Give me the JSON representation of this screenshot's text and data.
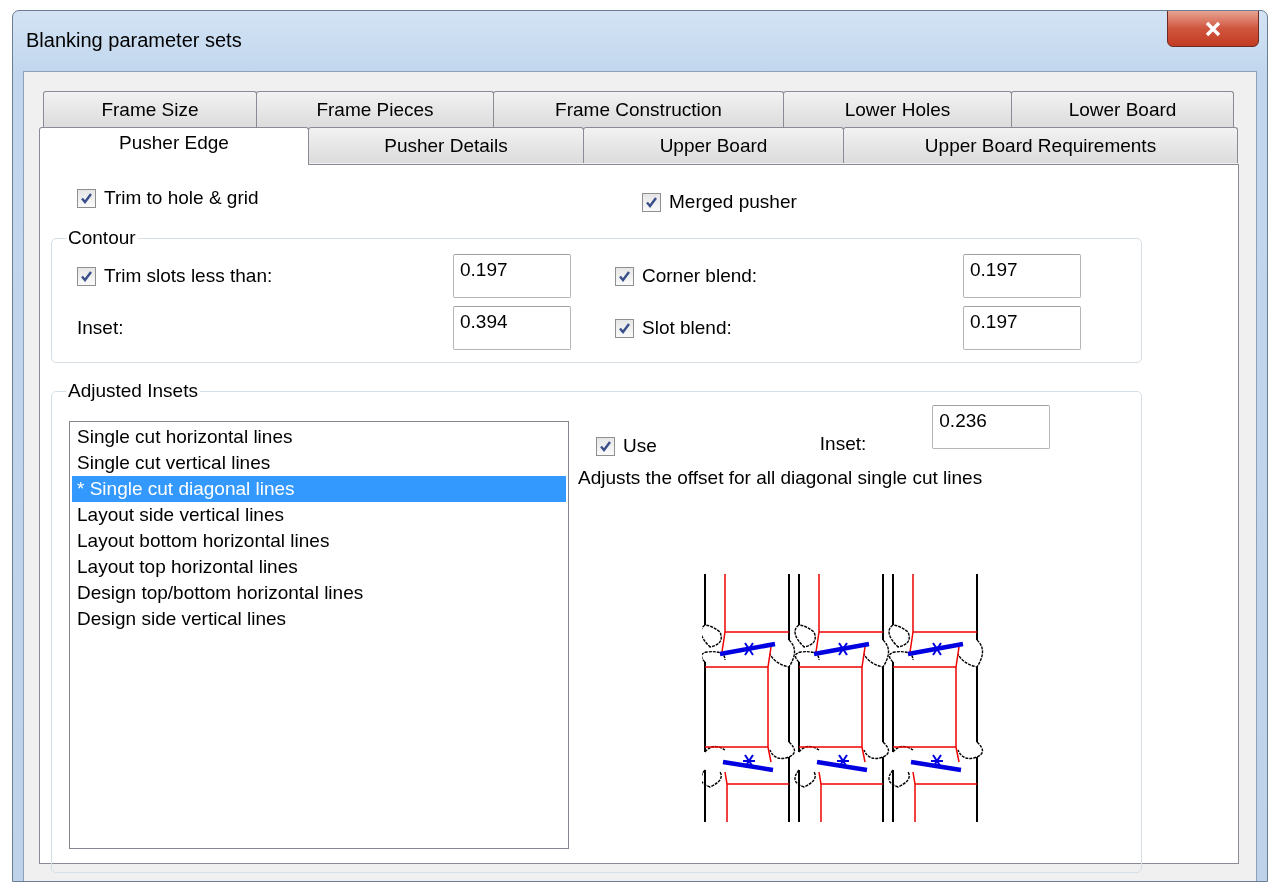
{
  "window": {
    "title": "Blanking parameter sets"
  },
  "tab_rows": [
    {
      "tabs": [
        {
          "label": "Frame Size",
          "selected": false
        },
        {
          "label": "Frame Pieces",
          "selected": false
        },
        {
          "label": "Frame Construction",
          "selected": false
        },
        {
          "label": "Lower Holes",
          "selected": false
        },
        {
          "label": "Lower Board",
          "selected": false
        }
      ]
    },
    {
      "tabs": [
        {
          "label": "Pusher Edge",
          "selected": true
        },
        {
          "label": "Pusher Details",
          "selected": false
        },
        {
          "label": "Upper Board",
          "selected": false
        },
        {
          "label": "Upper Board Requirements",
          "selected": false
        }
      ]
    }
  ],
  "options": [
    {
      "label": "Trim to hole & grid",
      "checked": true
    },
    {
      "label": "Merged pusher",
      "checked": true
    }
  ],
  "contour": {
    "title": "Contour",
    "fields": [
      {
        "kind": "check",
        "label": "Trim slots less than:",
        "checked": true,
        "value": "0.197"
      },
      {
        "kind": "check",
        "label": "Corner blend:",
        "checked": true,
        "value": "0.197"
      },
      {
        "kind": "label",
        "label": "Inset:",
        "value": "0.394"
      },
      {
        "kind": "check",
        "label": "Slot blend:",
        "checked": true,
        "value": "0.197"
      }
    ]
  },
  "adjusted_insets": {
    "title": "Adjusted Insets",
    "items": [
      {
        "label": "Single cut horizontal lines",
        "selected": false
      },
      {
        "label": "Single cut vertical lines",
        "selected": false
      },
      {
        "label": "* Single cut diagonal lines",
        "selected": true
      },
      {
        "label": "Layout side vertical lines",
        "selected": false
      },
      {
        "label": "Layout bottom horizontal lines",
        "selected": false
      },
      {
        "label": "Layout top horizontal lines",
        "selected": false
      },
      {
        "label": "Design top/bottom horizontal lines",
        "selected": false
      },
      {
        "label": "Design side vertical lines",
        "selected": false
      }
    ],
    "use": {
      "label": "Use",
      "checked": true
    },
    "inset": {
      "label": "Inset:",
      "value": "0.236"
    },
    "description": "Adjusts the offset for all diagonal single cut lines"
  }
}
